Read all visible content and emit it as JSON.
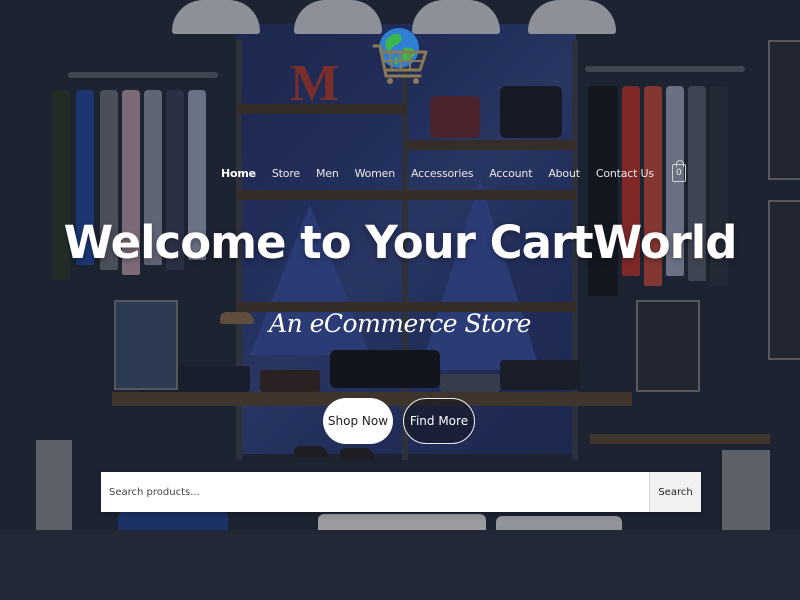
{
  "brand": {
    "logo_icon": "globe-cart-icon",
    "colors": {
      "globe_land": "#3cb54a",
      "globe_ocean": "#2f7fd6",
      "cart": "#8a7a55"
    }
  },
  "nav": {
    "items": [
      {
        "label": "Home",
        "active": true
      },
      {
        "label": "Store",
        "active": false
      },
      {
        "label": "Men",
        "active": false
      },
      {
        "label": "Women",
        "active": false
      },
      {
        "label": "Accessories",
        "active": false
      },
      {
        "label": "Account",
        "active": false
      },
      {
        "label": "About",
        "active": false
      },
      {
        "label": "Contact Us",
        "active": false
      }
    ],
    "cart_icon": "shopping-bag-icon",
    "cart_count": "0"
  },
  "hero": {
    "title": "Welcome to Your CartWorld",
    "subtitle": "An eCommerce Store",
    "primary_button": "Shop Now",
    "secondary_button": "Find More"
  },
  "search": {
    "placeholder": "Search products...",
    "value": "",
    "button_label": "Search"
  },
  "background": {
    "shelf_sign_letter": "M",
    "colors": {
      "banner": "#2d3e80",
      "overlay": "#121824"
    }
  }
}
